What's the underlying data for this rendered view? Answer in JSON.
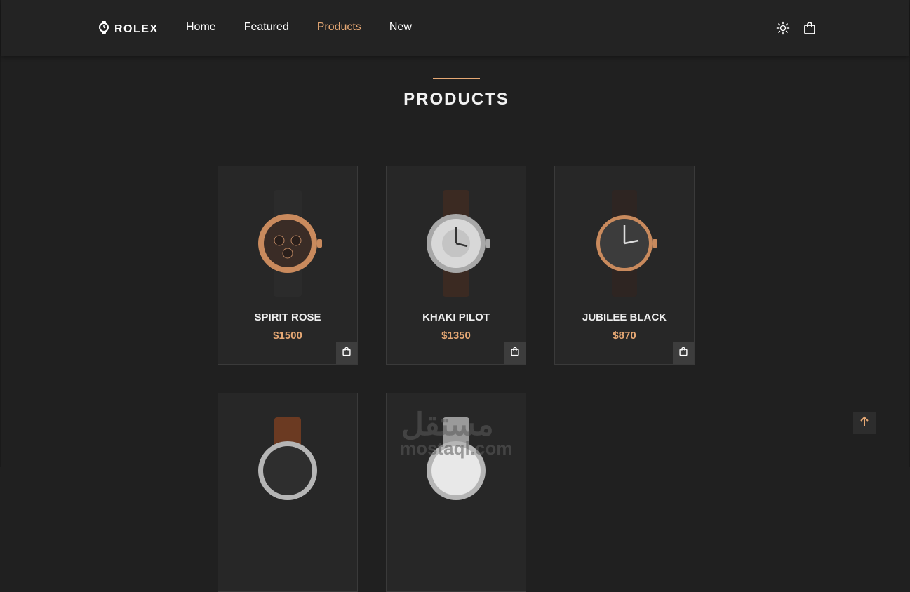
{
  "brand": {
    "name": "ROLEX",
    "icon": "watch-icon"
  },
  "nav": {
    "items": [
      {
        "label": "Home",
        "active": false
      },
      {
        "label": "Featured",
        "active": false
      },
      {
        "label": "Products",
        "active": true
      },
      {
        "label": "New",
        "active": false
      }
    ]
  },
  "header_icons": {
    "theme": "sun-icon",
    "cart": "shopping-bag-icon"
  },
  "section": {
    "title": "PRODUCTS"
  },
  "products": [
    {
      "name": "SPIRIT ROSE",
      "price": "$1500"
    },
    {
      "name": "KHAKI PILOT",
      "price": "$1350"
    },
    {
      "name": "JUBILEE BLACK",
      "price": "$870"
    },
    {
      "name": "",
      "price": ""
    },
    {
      "name": "",
      "price": ""
    }
  ],
  "watermark": {
    "arabic": "مستقل",
    "latin": "mostaql.com"
  },
  "colors": {
    "accent": "#e6a874",
    "background": "#202020",
    "card": "#272727",
    "header": "#232323"
  }
}
